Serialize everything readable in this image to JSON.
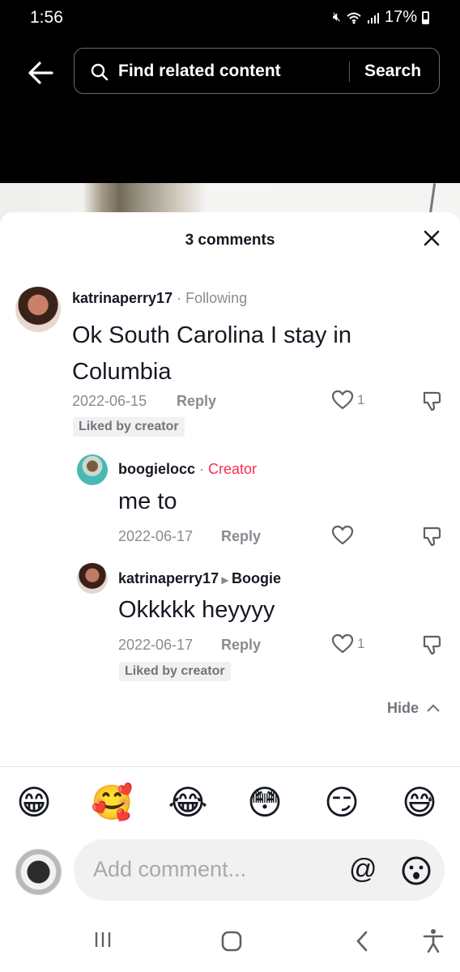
{
  "status_bar": {
    "time": "1:56",
    "battery": "17%",
    "icons": [
      "mute-icon",
      "wifi-icon",
      "signal-icon"
    ]
  },
  "header": {
    "search_placeholder": "Find related content",
    "search_button": "Search"
  },
  "sheet": {
    "title": "3 comments",
    "hide_label": "Hide"
  },
  "comments": [
    {
      "user": "katrinaperry17",
      "tag": "Following",
      "text_line1": "Ok South Carolina I stay in",
      "text_line2": "Columbia",
      "date": "2022-06-15",
      "reply": "Reply",
      "likes": "1",
      "badge": "Liked by creator"
    }
  ],
  "replies": [
    {
      "user": "boogielocc",
      "tag": "Creator",
      "text": "me to",
      "date": "2022-06-17",
      "reply": "Reply"
    },
    {
      "user": "katrinaperry17",
      "reply_to": "Boogie",
      "text": "Okkkkk heyyyy",
      "date": "2022-06-17",
      "reply": "Reply",
      "likes": "1",
      "badge": "Liked by creator"
    }
  ],
  "emojis": [
    "😁",
    "🥰",
    "😂",
    "😳",
    "😏",
    "😅"
  ],
  "composer": {
    "placeholder": "Add comment...",
    "mention": "@"
  },
  "colors": {
    "accent": "#fe2c55",
    "text": "#161823",
    "muted": "#8a8b91"
  }
}
